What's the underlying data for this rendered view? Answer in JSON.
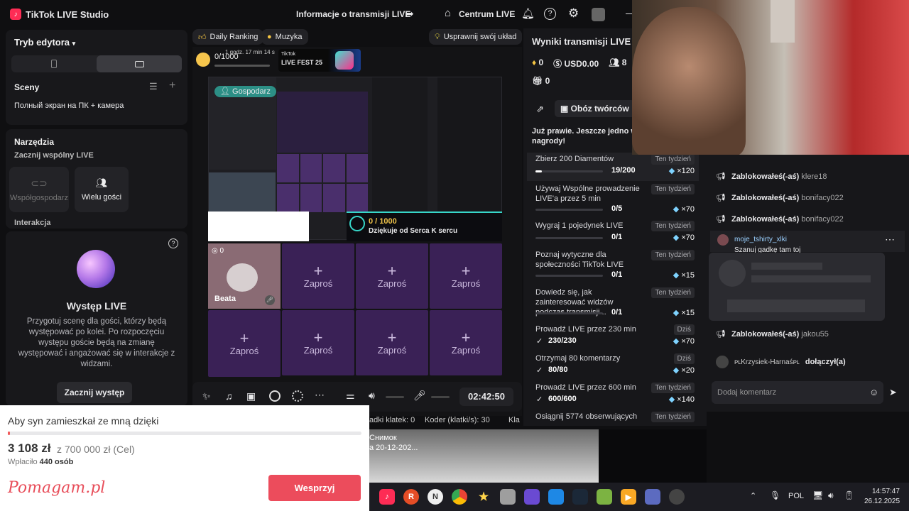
{
  "titlebar": {
    "app_name": "TikTok LIVE Studio",
    "stream_info": "Informacje o transmisji LIVE",
    "live_center": "Centrum LIVE"
  },
  "left": {
    "editor_mode": "Tryb edytora",
    "scenes_title": "Sceny",
    "scene_item": "Полный экран на ПК + камера",
    "tools_title": "Narzędzia",
    "joint_title": "Zacznij wspólny LIVE",
    "cohost": "Współgospodarz",
    "multi_guest": "Wielu gości",
    "interaction": "Interakcja",
    "perf_title": "Występ LIVE",
    "perf_desc": "Przygotuj scenę dla gości, którzy będą występować po kolei. Po rozpoczęciu występu goście będą na zmianę występować i angażować się w interakcje z widzami.",
    "perf_button": "Zacznij występ"
  },
  "stage": {
    "tab_ranking": "Daily Ranking",
    "tab_music": "Muzyka",
    "improve": "Usprawnij swój układ",
    "goal_count": "0/1000",
    "goal_time": "1 godz. 17 min 14 s",
    "fest_brand": "TikTok",
    "fest_title": "LIVE FEST 25",
    "host_label": "Gospodarz",
    "guest_count": "0",
    "guest_name": "Beata",
    "invite": "Zaproś",
    "heart_goal": "0 / 1000",
    "heart_thanks": "Dziękuje od Serca K sercu",
    "timer": "02:42:50"
  },
  "stats_strip": {
    "dropped": "adki klatek: 0",
    "encoder": "Koder (klatki/s): 30",
    "more": "Kla"
  },
  "capture": {
    "title": "Снимок",
    "date": "a 20-12-202..."
  },
  "fundraiser": {
    "title": "Aby syn zamieszkał ze mną dzięki",
    "amount": "3 108 zł",
    "goal": "z 700 000 zł (Cel)",
    "paid_label": "Wpłaciło",
    "paid_count": "440 osób",
    "brand": "Pomagam.pl",
    "button": "Wesprzyj",
    "progress": 0.0044
  },
  "results": {
    "title": "Wyniki transmisji LIVE",
    "diamonds": "0",
    "usd": "USD0.00",
    "users": "8",
    "gifts": "0",
    "creators": "Obóz twórców",
    "promo": "Już prawie. Jeszcze jedno w nagrody!",
    "tasks": [
      {
        "name": "Zbierz 200 Diamentów",
        "badge": "Ten tydzień",
        "progress": "19/200",
        "reward": "×120",
        "fraction": 0.095
      },
      {
        "name": "Używaj Wspólne prowadzenie LIVE'a przez 5 min",
        "badge": "Ten tydzień",
        "progress": "0/5",
        "reward": "×70",
        "fraction": 0
      },
      {
        "name": "Wygraj 1 pojedynek LIVE",
        "badge": "Ten tydzień",
        "progress": "0/1",
        "reward": "×70",
        "fraction": 0
      },
      {
        "name": "Poznaj wytyczne dla społeczności TikTok LIVE",
        "badge": "Ten tydzień",
        "progress": "0/1",
        "reward": "×15",
        "fraction": 0
      },
      {
        "name": "Dowiedz się, jak zainteresować widzów podczas transmisji...",
        "badge": "Ten tydzień",
        "progress": "0/1",
        "reward": "×15",
        "fraction": 0
      },
      {
        "name": "Prowadź LIVE przez 230 min",
        "badge": "Dziś",
        "progress": "230/230",
        "reward": "×70",
        "fraction": 1
      },
      {
        "name": "Otrzymaj 80 komentarzy",
        "badge": "Dziś",
        "progress": "80/80",
        "reward": "×20",
        "fraction": 1
      },
      {
        "name": "Prowadź LIVE przez 600 min",
        "badge": "Ten tydzień",
        "progress": "600/600",
        "reward": "×140",
        "fraction": 1
      },
      {
        "name": "Osiągnij 5774 obserwujących",
        "badge": "Ten tydzień",
        "progress": "",
        "reward": "",
        "fraction": 0
      }
    ]
  },
  "chat": {
    "blocked_label": "Zablokowałeś(-aś)",
    "blocked": [
      "klere18",
      "bonifacy022",
      "bonifacy022"
    ],
    "user_comment_name": "moje_tshirty_xlki",
    "user_comment_text": "Szanuj gadkę tam toj",
    "blocked_last": "jakou55",
    "joined_user": "ᴘʟKrzysiek-Harnaśᴘʟ",
    "joined_text": "dołączył(a)",
    "input_placeholder": "Dodaj komentarz"
  },
  "taskbar": {
    "lang": "POL",
    "time": "14:57:47",
    "date": "26.12.2025"
  }
}
